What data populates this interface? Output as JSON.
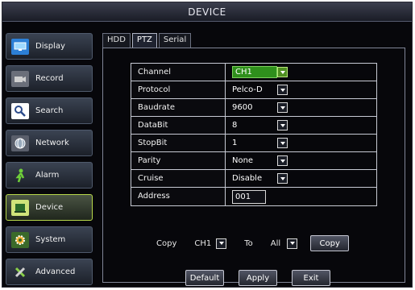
{
  "window": {
    "title": "DEVICE"
  },
  "sidebar": {
    "items": [
      {
        "label": "Display",
        "icon": "monitor-icon",
        "active": false
      },
      {
        "label": "Record",
        "icon": "camera-icon",
        "active": false
      },
      {
        "label": "Search",
        "icon": "magnifier-icon",
        "active": false
      },
      {
        "label": "Network",
        "icon": "globe-icon",
        "active": false
      },
      {
        "label": "Alarm",
        "icon": "alarm-person-icon",
        "active": false
      },
      {
        "label": "Device",
        "icon": "device-icon",
        "active": true
      },
      {
        "label": "System",
        "icon": "gear-icon",
        "active": false
      },
      {
        "label": "Advanced",
        "icon": "tools-icon",
        "active": false
      }
    ]
  },
  "tabs": [
    {
      "label": "HDD",
      "active": false
    },
    {
      "label": "PTZ",
      "active": true
    },
    {
      "label": "Serial",
      "active": false
    }
  ],
  "form": {
    "channel": {
      "label": "Channel",
      "value": "CH1"
    },
    "protocol": {
      "label": "Protocol",
      "value": "Pelco-D"
    },
    "baudrate": {
      "label": "Baudrate",
      "value": "9600"
    },
    "databit": {
      "label": "DataBit",
      "value": "8"
    },
    "stopbit": {
      "label": "StopBit",
      "value": "1"
    },
    "parity": {
      "label": "Parity",
      "value": "None"
    },
    "cruise": {
      "label": "Cruise",
      "value": "Disable"
    },
    "address": {
      "label": "Address",
      "value": "001"
    }
  },
  "copy": {
    "copy_label": "Copy",
    "from_value": "CH1",
    "to_label": "To",
    "to_value": "All",
    "button_label": "Copy"
  },
  "buttons": {
    "default_label": "Default",
    "apply_label": "Apply",
    "exit_label": "Exit"
  },
  "colors": {
    "highlight": "#2f8f1c",
    "active_border": "#b7d84a"
  }
}
